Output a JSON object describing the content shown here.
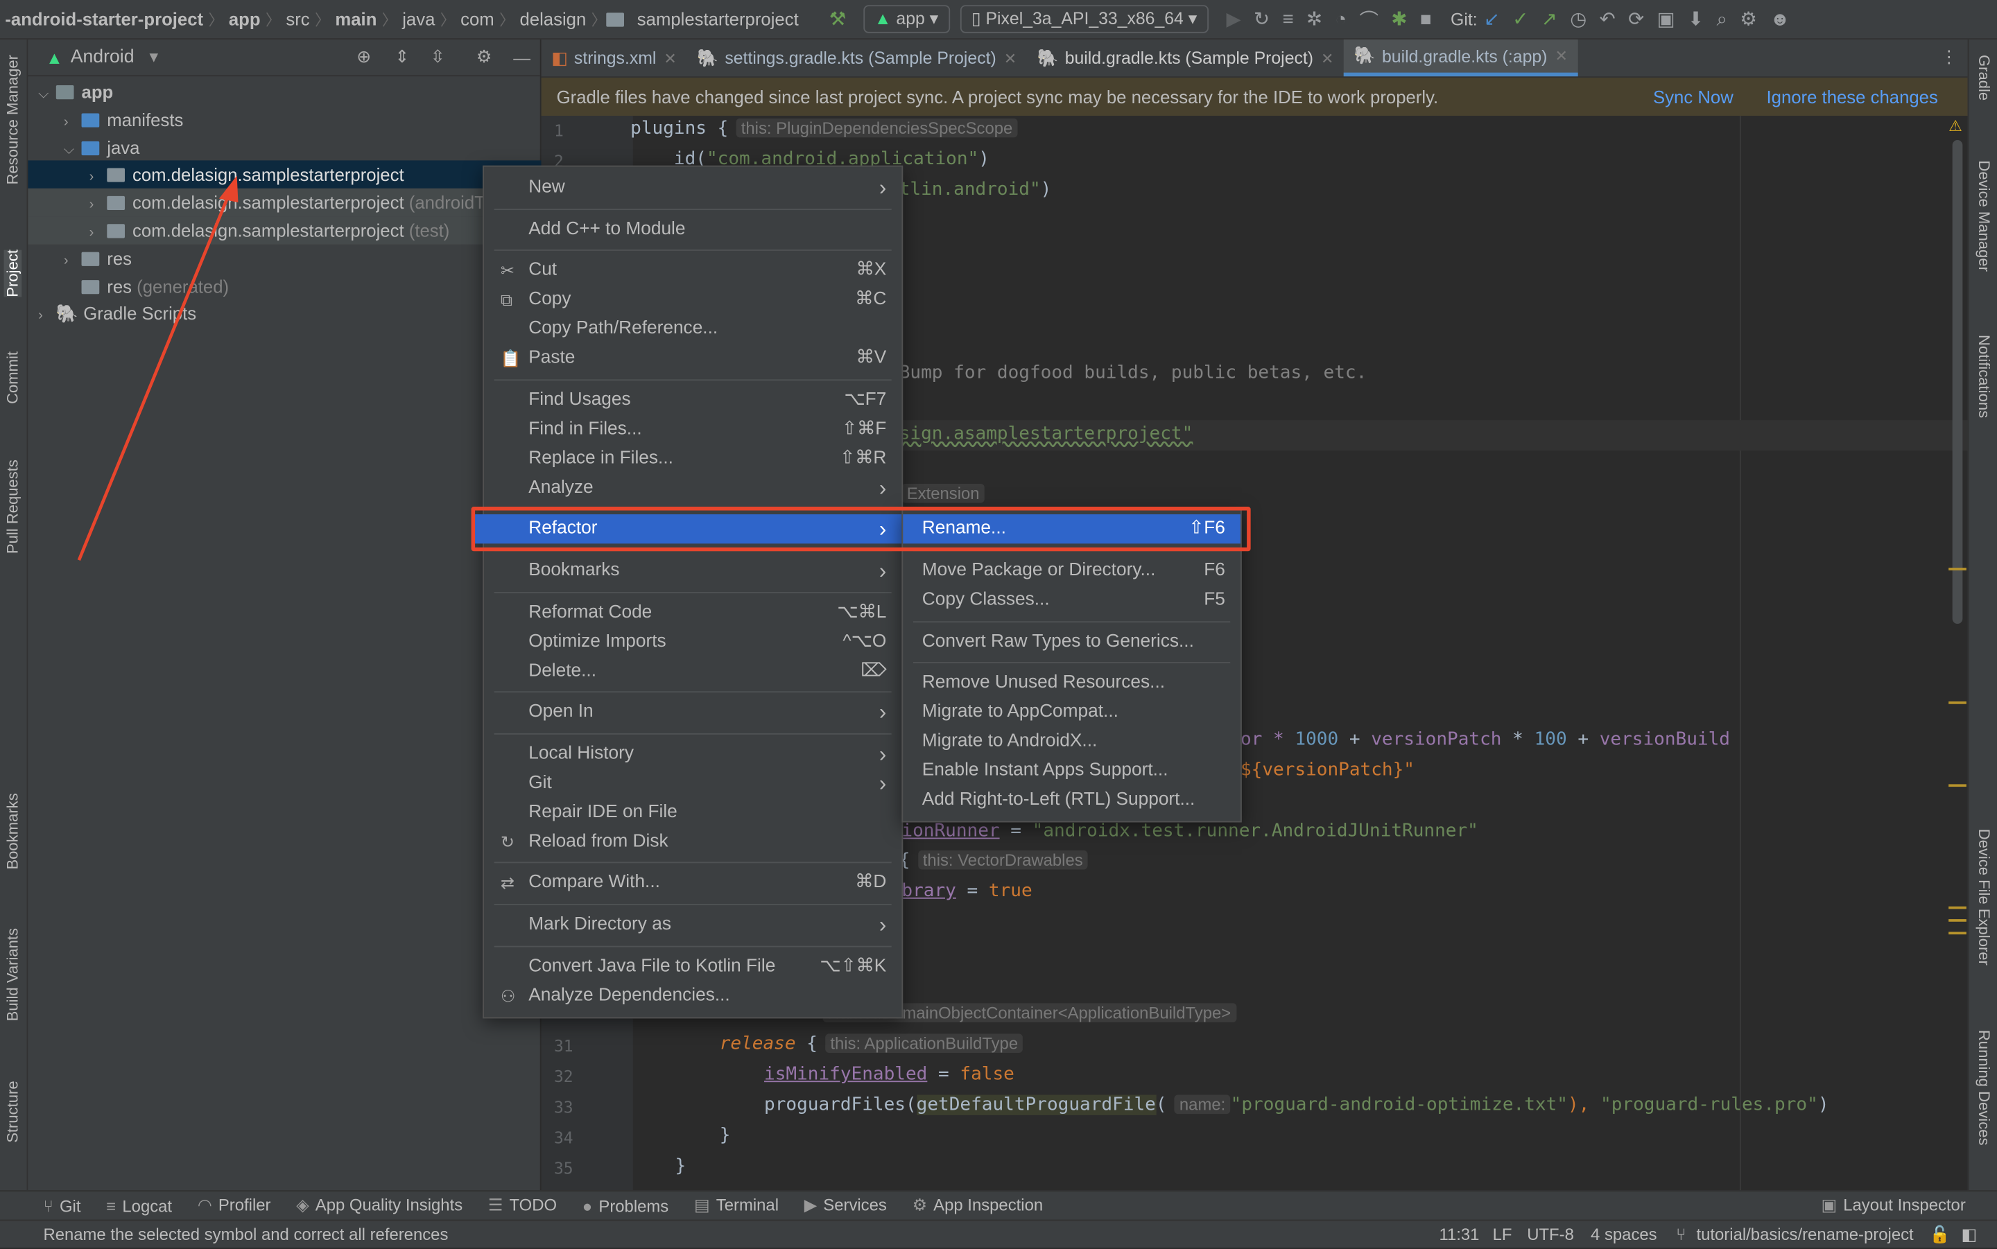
{
  "breadcrumb": [
    "-android-starter-project",
    "app",
    "src",
    "main",
    "java",
    "com",
    "delasign",
    "samplestarterproject"
  ],
  "toolbar": {
    "run_config": "app",
    "device": "Pixel_3a_API_33_x86_64",
    "git_label": "Git:"
  },
  "left_tools": [
    "Resource Manager",
    "Project",
    "Commit",
    "Pull Requests",
    "Bookmarks",
    "Build Variants",
    "Structure"
  ],
  "right_tools": [
    "Gradle",
    "Device Manager",
    "Notifications",
    "Device File Explorer",
    "Running Devices"
  ],
  "project": {
    "view": "Android",
    "tree": [
      {
        "label": "app",
        "bold": true
      },
      {
        "label": "manifests"
      },
      {
        "label": "java"
      },
      {
        "label": "com.delasign.samplestarterproject",
        "selected": true
      },
      {
        "label": "com.delasign.samplestarterproject",
        "suffix": "(androidTest)"
      },
      {
        "label": "com.delasign.samplestarterproject",
        "suffix": "(test)"
      },
      {
        "label": "res"
      },
      {
        "label": "res",
        "suffix": "(generated)"
      },
      {
        "label": "Gradle Scripts"
      }
    ]
  },
  "tabs": [
    {
      "label": "strings.xml"
    },
    {
      "label": "settings.gradle.kts (Sample Project)"
    },
    {
      "label": "build.gradle.kts (Sample Project)"
    },
    {
      "label": "build.gradle.kts (:app)",
      "active": true
    }
  ],
  "banner": {
    "message": "Gradle files have changed since last project sync. A project sync may be necessary for the IDE to work properly.",
    "sync": "Sync Now",
    "ignore": "Ignore these changes"
  },
  "code": {
    "l1": "plugins {",
    "l1hint": "this: PluginDependenciesSpecScope",
    "l2a": "    id(",
    "l2b": "\"com.android.application\"",
    "l2c": ")",
    "l3a": "tlin.android\"",
    "l3b": ")",
    "l9": "Bump for dogfood builds, public betas, etc.",
    "l11": "sign.asamplestarterproject\"",
    "l13hint": "Extension",
    "l21a": "or * ",
    "l21b": "1000",
    "l21c": " + ",
    "l21d": "versionPatch",
    "l21e": " * ",
    "l21f": "100",
    "l21g": " + ",
    "l21h": "versionBuild",
    "l22": "${versionPatch}\"",
    "l24a": "ionRunner",
    "l24b": " = ",
    "l24c": "\"androidx.test.runner.AndroidJUnitRunner\"",
    "l25a": "{",
    "l25hint": "this: VectorDrawables",
    "l26a": "brary",
    "l26b": " = ",
    "l26c": "true",
    "l30hint": "NamedDomainObjectContainer<ApplicationBuildType>",
    "l31a": "release",
    "l31b": " {",
    "l31hint": "this: ApplicationBuildType",
    "l32a": "isMinifyEnabled",
    "l32b": " = ",
    "l32c": "false",
    "l33a": "proguardFiles(",
    "l33b": "getDefaultProguardFile",
    "l33c": "(",
    "l33hint": "name:",
    "l33d": "\"proguard-android-optimize.txt\"",
    "l33e": "), ",
    "l33f": "\"proguard-rules.pro\"",
    "l33g": ")",
    "l34": "}",
    "l35": "}"
  },
  "line_numbers": [
    "1",
    "2",
    "31",
    "32",
    "33",
    "34",
    "35"
  ],
  "context_menu": [
    {
      "label": "New",
      "submenu": true
    },
    {
      "label": "Add C++ to Module"
    },
    {
      "label": "Cut",
      "shortcut": "⌘X",
      "icon": "scissors-icon"
    },
    {
      "label": "Copy",
      "shortcut": "⌘C",
      "icon": "copy-icon"
    },
    {
      "label": "Copy Path/Reference..."
    },
    {
      "label": "Paste",
      "shortcut": "⌘V",
      "icon": "paste-icon"
    },
    {
      "label": "Find Usages",
      "shortcut": "⌥F7"
    },
    {
      "label": "Find in Files...",
      "shortcut": "⇧⌘F"
    },
    {
      "label": "Replace in Files...",
      "shortcut": "⇧⌘R"
    },
    {
      "label": "Analyze",
      "submenu": true
    },
    {
      "label": "Refactor",
      "submenu": true,
      "highlighted": true
    },
    {
      "label": "Bookmarks",
      "submenu": true
    },
    {
      "label": "Reformat Code",
      "shortcut": "⌥⌘L"
    },
    {
      "label": "Optimize Imports",
      "shortcut": "^⌥O"
    },
    {
      "label": "Delete...",
      "shortcut": "⌦"
    },
    {
      "label": "Open In",
      "submenu": true
    },
    {
      "label": "Local History",
      "submenu": true
    },
    {
      "label": "Git",
      "submenu": true
    },
    {
      "label": "Repair IDE on File"
    },
    {
      "label": "Reload from Disk",
      "icon": "reload-icon"
    },
    {
      "label": "Compare With...",
      "shortcut": "⌘D",
      "icon": "compare-icon"
    },
    {
      "label": "Mark Directory as",
      "submenu": true
    },
    {
      "label": "Convert Java File to Kotlin File",
      "shortcut": "⌥⇧⌘K"
    },
    {
      "label": "Analyze Dependencies...",
      "icon": "analyze-dependencies-icon"
    }
  ],
  "refactor_submenu": [
    {
      "label": "Rename...",
      "shortcut": "⇧F6",
      "highlighted": true
    },
    {
      "label": "Move Package or Directory...",
      "shortcut": "F6"
    },
    {
      "label": "Copy Classes...",
      "shortcut": "F5"
    },
    {
      "label": "Convert Raw Types to Generics..."
    },
    {
      "label": "Remove Unused Resources..."
    },
    {
      "label": "Migrate to AppCompat..."
    },
    {
      "label": "Migrate to AndroidX..."
    },
    {
      "label": "Enable Instant Apps Support..."
    },
    {
      "label": "Add Right-to-Left (RTL) Support..."
    }
  ],
  "bottom_tools": [
    "Git",
    "Logcat",
    "Profiler",
    "App Quality Insights",
    "TODO",
    "Problems",
    "Terminal",
    "Services",
    "App Inspection",
    "Layout Inspector"
  ],
  "status": {
    "message": "Rename the selected symbol and correct all references",
    "position": "11:31",
    "line_sep": "LF",
    "encoding": "UTF-8",
    "indent": "4 spaces",
    "branch": "tutorial/basics/rename-project"
  },
  "colors": {
    "highlight": "#2f65ca",
    "annotation": "#e8452c",
    "link": "#589df6",
    "banner_bg": "#48412e"
  }
}
